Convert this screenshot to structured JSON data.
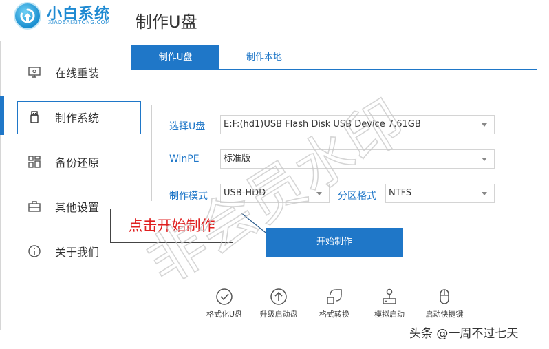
{
  "brand": {
    "name": "小白系统",
    "sub": "XIAOBAIXITONG.COM"
  },
  "page_title": "制作U盘",
  "sidebar": {
    "items": [
      {
        "label": "在线重装",
        "icon": "monitor-icon"
      },
      {
        "label": "制作系统",
        "icon": "usb-drive-icon",
        "active": true
      },
      {
        "label": "备份还原",
        "icon": "grid-icon"
      },
      {
        "label": "其他设置",
        "icon": "toolbox-icon"
      },
      {
        "label": "关于我们",
        "icon": "info-icon"
      }
    ]
  },
  "tabs": [
    {
      "label": "制作U盘",
      "active": true
    },
    {
      "label": "制作本地",
      "active": false
    }
  ],
  "form": {
    "usb_label": "选择U盘",
    "usb_value": "E:F:(hd1)USB Flash Disk USB Device 7.61GB",
    "winpe_label": "WinPE",
    "winpe_value": "标准版",
    "mode_label": "制作模式",
    "mode_value": "USB-HDD",
    "partition_label": "分区格式",
    "partition_value": "NTFS"
  },
  "callout": "点击开始制作",
  "start_button": "开始制作",
  "tools": [
    {
      "label": "格式化U盘",
      "icon": "check-circle-icon"
    },
    {
      "label": "升级启动盘",
      "icon": "arrow-up-circle-icon"
    },
    {
      "label": "格式转换",
      "icon": "convert-icon"
    },
    {
      "label": "模拟启动",
      "icon": "joystick-icon"
    },
    {
      "label": "启动快捷键",
      "icon": "mouse-icon"
    }
  ],
  "watermark": "非会员水印",
  "attribution": "头条 @一周不过七天",
  "colors": {
    "accent": "#1f77c8",
    "callout_text": "#e02020"
  }
}
